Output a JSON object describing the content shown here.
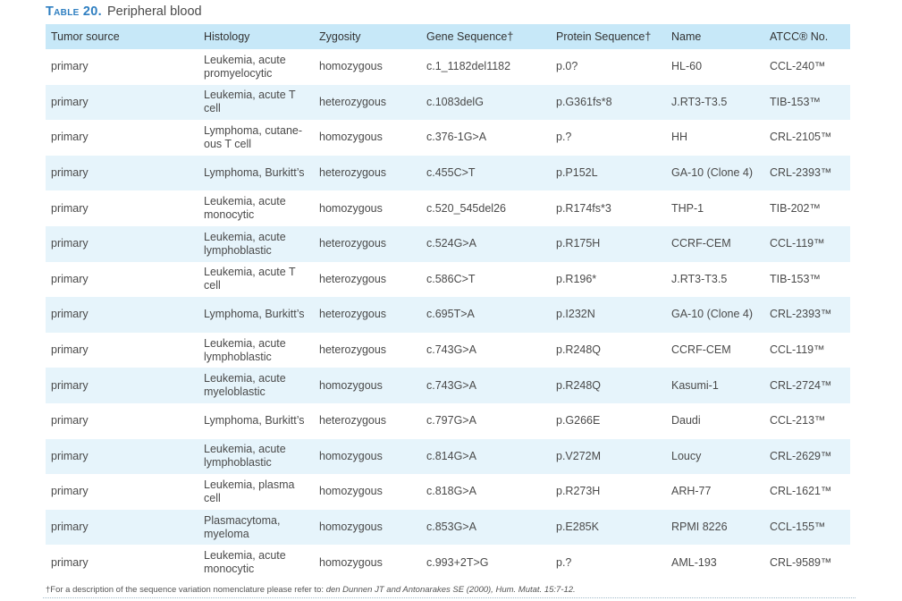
{
  "caption": {
    "label": "Table 20.",
    "title": "Peripheral blood"
  },
  "columns": [
    "Tumor source",
    "Histology",
    "Zygosity",
    "Gene Sequence†",
    "Protein Sequence†",
    "Name",
    "ATCC® No."
  ],
  "rows": [
    [
      "primary",
      "Leukemia, acute promyelocytic",
      "homozygous",
      "c.1_1182del1182",
      "p.0?",
      "HL-60",
      "CCL-240™"
    ],
    [
      "primary",
      "Leukemia, acute T cell",
      "heterozygous",
      "c.1083delG",
      "p.G361fs*8",
      "J.RT3-T3.5",
      "TIB-153™"
    ],
    [
      "primary",
      "Lymphoma, cutane-ous T cell",
      "homozygous",
      "c.376-1G>A",
      "p.?",
      "HH",
      "CRL-2105™"
    ],
    [
      "primary",
      "Lymphoma, Burkitt’s",
      "heterozygous",
      "c.455C>T",
      "p.P152L",
      "GA-10 (Clone 4)",
      "CRL-2393™"
    ],
    [
      "primary",
      "Leukemia, acute monocytic",
      "homozygous",
      "c.520_545del26",
      "p.R174fs*3",
      "THP-1",
      "TIB-202™"
    ],
    [
      "primary",
      "Leukemia, acute lymphoblastic",
      "heterozygous",
      "c.524G>A",
      "p.R175H",
      "CCRF-CEM",
      "CCL-119™"
    ],
    [
      "primary",
      "Leukemia, acute T cell",
      "heterozygous",
      "c.586C>T",
      "p.R196*",
      "J.RT3-T3.5",
      "TIB-153™"
    ],
    [
      "primary",
      "Lymphoma, Burkitt’s",
      "heterozygous",
      "c.695T>A",
      "p.I232N",
      "GA-10 (Clone 4)",
      "CRL-2393™"
    ],
    [
      "primary",
      "Leukemia, acute lymphoblastic",
      "heterozygous",
      "c.743G>A",
      "p.R248Q",
      "CCRF-CEM",
      "CCL-119™"
    ],
    [
      "primary",
      "Leukemia, acute myeloblastic",
      "homozygous",
      "c.743G>A",
      "p.R248Q",
      "Kasumi-1",
      "CRL-2724™"
    ],
    [
      "primary",
      "Lymphoma, Burkitt’s",
      "heterozygous",
      "c.797G>A",
      "p.G266E",
      "Daudi",
      "CCL-213™"
    ],
    [
      "primary",
      "Leukemia, acute lymphoblastic",
      "homozygous",
      "c.814G>A",
      "p.V272M",
      "Loucy",
      "CRL-2629™"
    ],
    [
      "primary",
      "Leukemia, plasma cell",
      "homozygous",
      "c.818G>A",
      "p.R273H",
      "ARH-77",
      "CRL-1621™"
    ],
    [
      "primary",
      "Plasmacytoma, myeloma",
      "homozygous",
      "c.853G>A",
      "p.E285K",
      "RPMI 8226",
      "CCL-155™"
    ],
    [
      "primary",
      "Leukemia, acute monocytic",
      "homozygous",
      "c.993+2T>G",
      "p.?",
      "AML-193",
      "CRL-9589™"
    ]
  ],
  "footnote": {
    "text": "†For a description of the sequence variation nomenclature please refer to: ",
    "citation": "den Dunnen JT and Antonarakes SE (2000), Hum. Mutat. 15:7-12."
  }
}
